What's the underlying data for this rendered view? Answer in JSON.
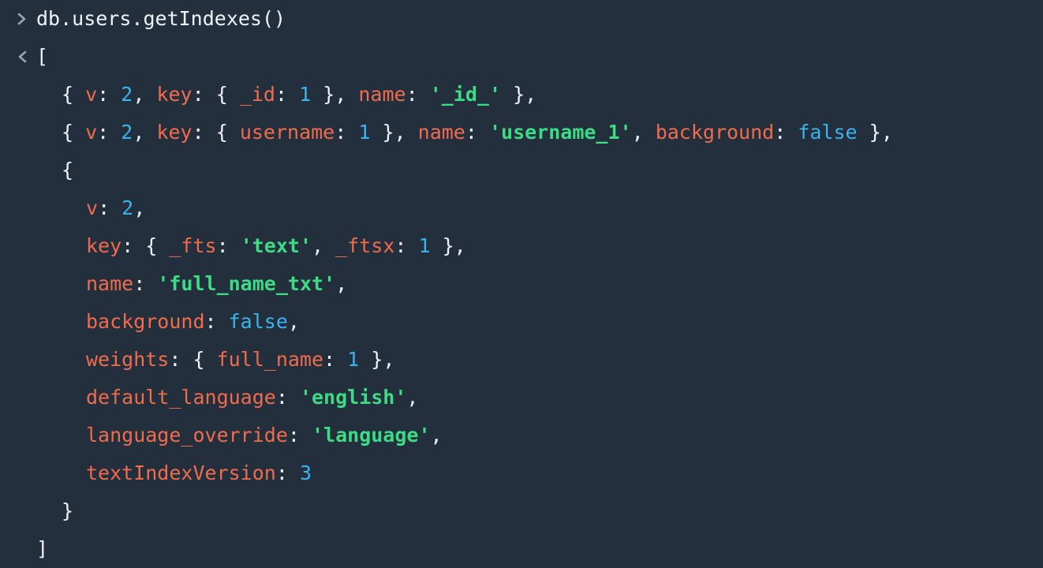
{
  "console": {
    "input_icon": "chevron-right-icon",
    "output_icon": "chevron-left-icon",
    "command": "db.users.getIndexes()",
    "colors": {
      "background": "#232f3c",
      "key": "#f06c4d",
      "number": "#39b4ef",
      "string": "#3ddc84",
      "punctuation": "#eef2f6"
    },
    "output_lines": [
      [
        {
          "t": "p",
          "v": "["
        }
      ],
      [
        {
          "t": "p",
          "v": "{ "
        },
        {
          "t": "k",
          "v": "v"
        },
        {
          "t": "p",
          "v": ": "
        },
        {
          "t": "n",
          "v": "2"
        },
        {
          "t": "p",
          "v": ", "
        },
        {
          "t": "k",
          "v": "key"
        },
        {
          "t": "p",
          "v": ": { "
        },
        {
          "t": "k",
          "v": "_id"
        },
        {
          "t": "p",
          "v": ": "
        },
        {
          "t": "n",
          "v": "1"
        },
        {
          "t": "p",
          "v": " }, "
        },
        {
          "t": "k",
          "v": "name"
        },
        {
          "t": "p",
          "v": ": "
        },
        {
          "t": "s",
          "v": "'_id_'"
        },
        {
          "t": "p",
          "v": " },"
        }
      ],
      [
        {
          "t": "p",
          "v": "{ "
        },
        {
          "t": "k",
          "v": "v"
        },
        {
          "t": "p",
          "v": ": "
        },
        {
          "t": "n",
          "v": "2"
        },
        {
          "t": "p",
          "v": ", "
        },
        {
          "t": "k",
          "v": "key"
        },
        {
          "t": "p",
          "v": ": { "
        },
        {
          "t": "k",
          "v": "username"
        },
        {
          "t": "p",
          "v": ": "
        },
        {
          "t": "n",
          "v": "1"
        },
        {
          "t": "p",
          "v": " }, "
        },
        {
          "t": "k",
          "v": "name"
        },
        {
          "t": "p",
          "v": ": "
        },
        {
          "t": "s",
          "v": "'username_1'"
        },
        {
          "t": "p",
          "v": ", "
        },
        {
          "t": "k",
          "v": "background"
        },
        {
          "t": "p",
          "v": ": "
        },
        {
          "t": "n",
          "v": "false"
        },
        {
          "t": "p",
          "v": " },"
        }
      ],
      [
        {
          "t": "p",
          "v": "{"
        }
      ],
      [
        {
          "t": "k",
          "v": "v"
        },
        {
          "t": "p",
          "v": ": "
        },
        {
          "t": "n",
          "v": "2"
        },
        {
          "t": "p",
          "v": ","
        }
      ],
      [
        {
          "t": "k",
          "v": "key"
        },
        {
          "t": "p",
          "v": ": { "
        },
        {
          "t": "k",
          "v": "_fts"
        },
        {
          "t": "p",
          "v": ": "
        },
        {
          "t": "s",
          "v": "'text'"
        },
        {
          "t": "p",
          "v": ", "
        },
        {
          "t": "k",
          "v": "_ftsx"
        },
        {
          "t": "p",
          "v": ": "
        },
        {
          "t": "n",
          "v": "1"
        },
        {
          "t": "p",
          "v": " },"
        }
      ],
      [
        {
          "t": "k",
          "v": "name"
        },
        {
          "t": "p",
          "v": ": "
        },
        {
          "t": "s",
          "v": "'full_name_txt'"
        },
        {
          "t": "p",
          "v": ","
        }
      ],
      [
        {
          "t": "k",
          "v": "background"
        },
        {
          "t": "p",
          "v": ": "
        },
        {
          "t": "n",
          "v": "false"
        },
        {
          "t": "p",
          "v": ","
        }
      ],
      [
        {
          "t": "k",
          "v": "weights"
        },
        {
          "t": "p",
          "v": ": { "
        },
        {
          "t": "k",
          "v": "full_name"
        },
        {
          "t": "p",
          "v": ": "
        },
        {
          "t": "n",
          "v": "1"
        },
        {
          "t": "p",
          "v": " },"
        }
      ],
      [
        {
          "t": "k",
          "v": "default_language"
        },
        {
          "t": "p",
          "v": ": "
        },
        {
          "t": "s",
          "v": "'english'"
        },
        {
          "t": "p",
          "v": ","
        }
      ],
      [
        {
          "t": "k",
          "v": "language_override"
        },
        {
          "t": "p",
          "v": ": "
        },
        {
          "t": "s",
          "v": "'language'"
        },
        {
          "t": "p",
          "v": ","
        }
      ],
      [
        {
          "t": "k",
          "v": "textIndexVersion"
        },
        {
          "t": "p",
          "v": ": "
        },
        {
          "t": "n",
          "v": "3"
        }
      ],
      [
        {
          "t": "p",
          "v": "}"
        }
      ],
      [
        {
          "t": "p",
          "v": "]"
        }
      ]
    ]
  }
}
